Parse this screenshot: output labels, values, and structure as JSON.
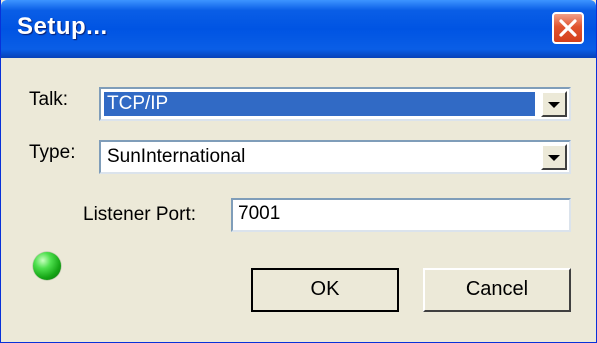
{
  "window": {
    "title": "Setup..."
  },
  "talk": {
    "label": "Talk:",
    "value": "TCP/IP"
  },
  "type": {
    "label": "Type:",
    "value": "SunInternational"
  },
  "listener_port": {
    "label": "Listener Port:",
    "value": "7001"
  },
  "status": {
    "indicator_color": "#2ec42e"
  },
  "buttons": {
    "ok": "OK",
    "cancel": "Cancel"
  },
  "colors": {
    "titlebar": "#0054e3",
    "selection": "#316ac5",
    "close_button": "#e1542f",
    "dialog_bg": "#ece9d8"
  }
}
